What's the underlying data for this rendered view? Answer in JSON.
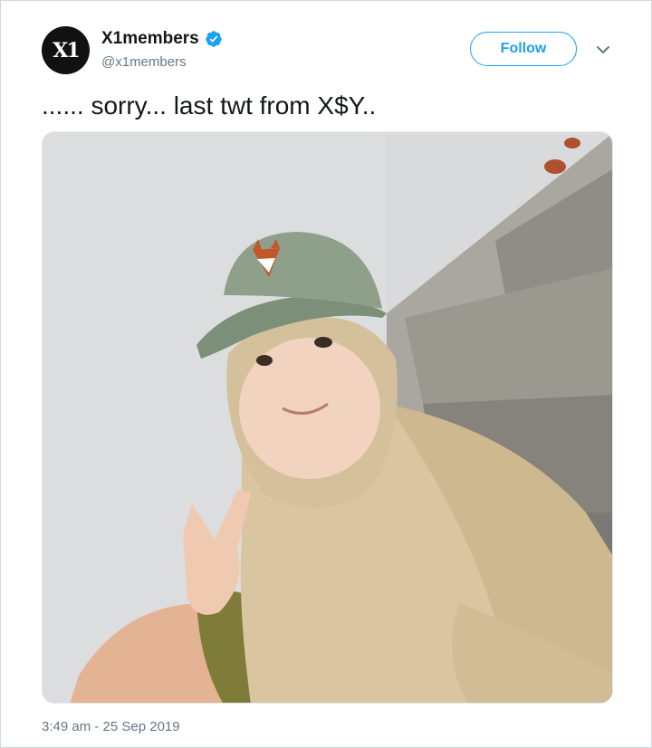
{
  "tweet": {
    "avatar_logo": "X1",
    "display_name": "X1members",
    "handle": "@x1members",
    "follow_label": "Follow",
    "text": "...... sorry... last twt from X$Y..",
    "timestamp": "3:49 am - 25 Sep 2019",
    "verified_icon": "verified-badge-icon",
    "accent_color": "#1da1f2"
  }
}
